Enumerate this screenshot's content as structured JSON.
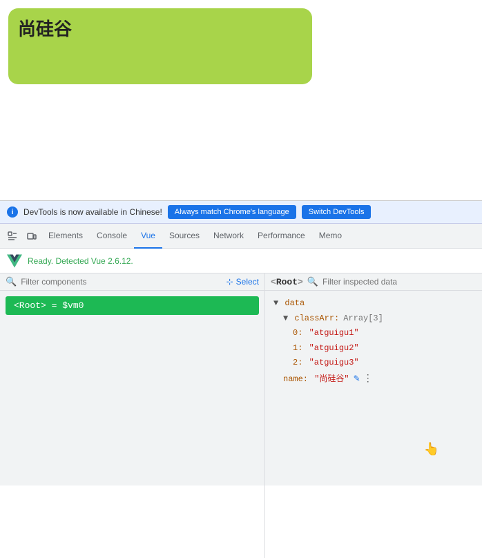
{
  "page": {
    "green_box_text": "尚硅谷"
  },
  "info_bar": {
    "icon": "i",
    "message": "DevTools is now available in Chinese!",
    "btn1_label": "Always match Chrome's language",
    "btn2_label": "Switch DevTools"
  },
  "tabs": {
    "items": [
      {
        "label": "Elements",
        "active": false
      },
      {
        "label": "Console",
        "active": false
      },
      {
        "label": "Vue",
        "active": true
      },
      {
        "label": "Sources",
        "active": false
      },
      {
        "label": "Network",
        "active": false
      },
      {
        "label": "Performance",
        "active": false
      },
      {
        "label": "Memo",
        "active": false
      }
    ]
  },
  "vue_header": {
    "ready_text": "Ready. Detected Vue 2.6.12."
  },
  "left_panel": {
    "filter_placeholder": "Filter components",
    "select_label": "Select",
    "root_item": "＜Root＞ = $vm0"
  },
  "right_panel": {
    "root_label": "＜Root＞",
    "filter_placeholder": "Filter inspected data",
    "data": {
      "key": "data",
      "classArr": {
        "key": "classArr",
        "type": "Array[3]",
        "items": [
          {
            "index": "0",
            "value": "\"atguigu1\""
          },
          {
            "index": "1",
            "value": "\"atguigu2\""
          },
          {
            "index": "2",
            "value": "\"atguigu3\""
          }
        ]
      },
      "name": {
        "key": "name",
        "value": "\"尚硅谷\""
      }
    }
  }
}
